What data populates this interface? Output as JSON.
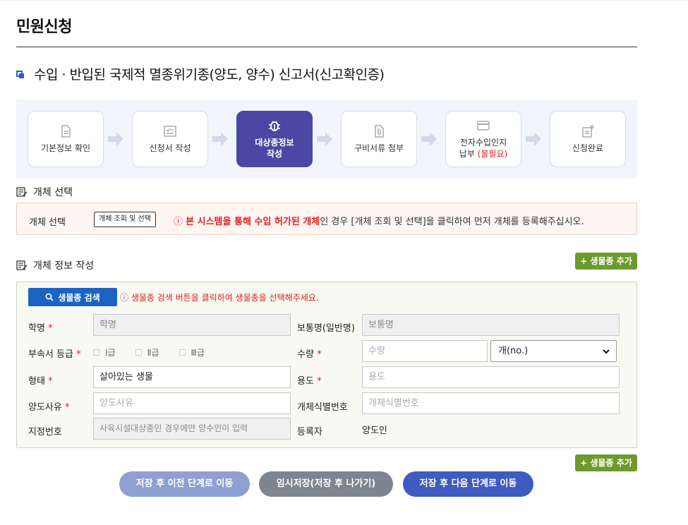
{
  "page": {
    "title": "민원신청"
  },
  "form": {
    "title": "수입 · 반입된 국제적 멸종위기종(양도, 양수) 신고서(신고확인증)"
  },
  "steps": [
    {
      "label": "기본정보 확인",
      "icon": "document-icon",
      "active": false
    },
    {
      "label": "신청서 작성",
      "icon": "checklist-icon",
      "active": false
    },
    {
      "label_line1": "대상종정보",
      "label_line2": "작성",
      "icon": "bug-icon",
      "active": true
    },
    {
      "label": "구비서류 첨부",
      "icon": "paperclip-document-icon",
      "active": false
    },
    {
      "label_line1": "전자수입인지",
      "label_line2_prefix": "납부 ",
      "label_line2_req": "(불필요)",
      "icon": "card-icon",
      "active": false
    },
    {
      "label": "신청완료",
      "icon": "edit-plus-icon",
      "active": false
    }
  ],
  "object_select": {
    "heading": "개체 선택",
    "label": "개체 선택",
    "lookup_button": "개체 조회 및 선택",
    "notice_icon": "ⓘ",
    "notice_red": "본 시스템을 통해 수입 허가된 개체",
    "notice_rest": "인 경우 [개체 조회 및 선택]을 클릭하여 먼저 개체를 등록해주십시오."
  },
  "object_info": {
    "heading": "개체 정보 작성",
    "add_species_button": "+ 생물종 추가",
    "search_button": "생물종 검색",
    "search_notice": "ⓘ 생물종 검색 버튼을 클릭하여 생물종을 선택해주세요.",
    "fields": {
      "scientific_name": {
        "label": "학명",
        "placeholder": "학명"
      },
      "common_name": {
        "label": "보통명(일반명)",
        "placeholder": "보통명"
      },
      "appendix_grade": {
        "label": "부속서 등급",
        "options": [
          "Ⅰ급",
          "Ⅱ급",
          "Ⅲ급"
        ]
      },
      "quantity": {
        "label": "수량",
        "placeholder": "수량",
        "unit": "개(no.)"
      },
      "form_type": {
        "label": "형태",
        "value": "살아있는 생물"
      },
      "purpose": {
        "label": "용도",
        "placeholder": "용도"
      },
      "transfer_reason": {
        "label": "양도사유",
        "placeholder": "양도사유"
      },
      "object_id": {
        "label": "개체식별번호",
        "placeholder": "개체식별번호"
      },
      "designation_no": {
        "label": "지정번호",
        "placeholder": "사육시설대상종인 경우에만 양수인이 입력"
      },
      "registrant": {
        "label": "등록자",
        "value": "양도인"
      }
    },
    "required_mark": "*"
  },
  "bottom_add_button": "+ 생물종 추가",
  "actions": {
    "prev": "저장 후 이전 단계로 이동",
    "temp": "임시저장(저장 후 나가기)",
    "next": "저장 후 다음 단계로 이동"
  },
  "colors": {
    "active_step": "#4a48a4",
    "add_button": "#6d9a2d",
    "search_button": "#1b64c4",
    "required": "#e02020",
    "btn_prev": "#8f9fd1",
    "btn_temp": "#7d8590",
    "btn_next": "#3f5bbf"
  }
}
